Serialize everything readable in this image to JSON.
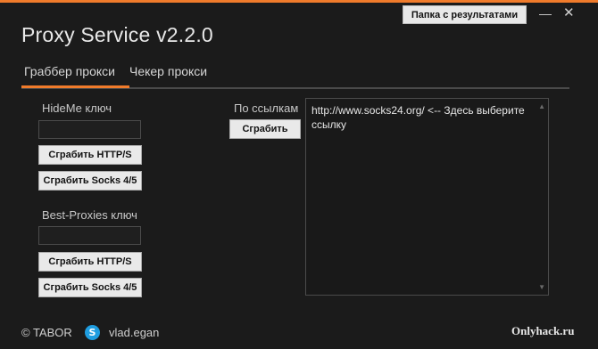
{
  "app": {
    "title": "Proxy Service v2.2.0",
    "results_button": "Папка с результатами",
    "minimize_label": "—",
    "close_label": "✕"
  },
  "tabs": [
    {
      "label": "Граббер прокси",
      "active": true
    },
    {
      "label": "Чекер прокси",
      "active": false
    }
  ],
  "hideme": {
    "label": "HideMe ключ",
    "value": "",
    "grab_http": "Сграбить HTTP/S",
    "grab_socks": "Сграбить Socks 4/5"
  },
  "bestproxies": {
    "label": "Best-Proxies ключ",
    "value": "",
    "grab_http": "Сграбить HTTP/S",
    "grab_socks": "Сграбить Socks 4/5"
  },
  "links": {
    "label": "По ссылкам",
    "grab_button": "Сграбить",
    "text": "http://www.socks24.org/ <-- Здесь выберите ссылку"
  },
  "footer": {
    "copyright": "© TABOR",
    "skype_icon_glyph": "S",
    "skype_name": "vlad.egan",
    "watermark": "Onlyhack.ru"
  },
  "colors": {
    "accent": "#f07b2b",
    "background": "#1b1b1b",
    "skype": "#1f9de0"
  }
}
